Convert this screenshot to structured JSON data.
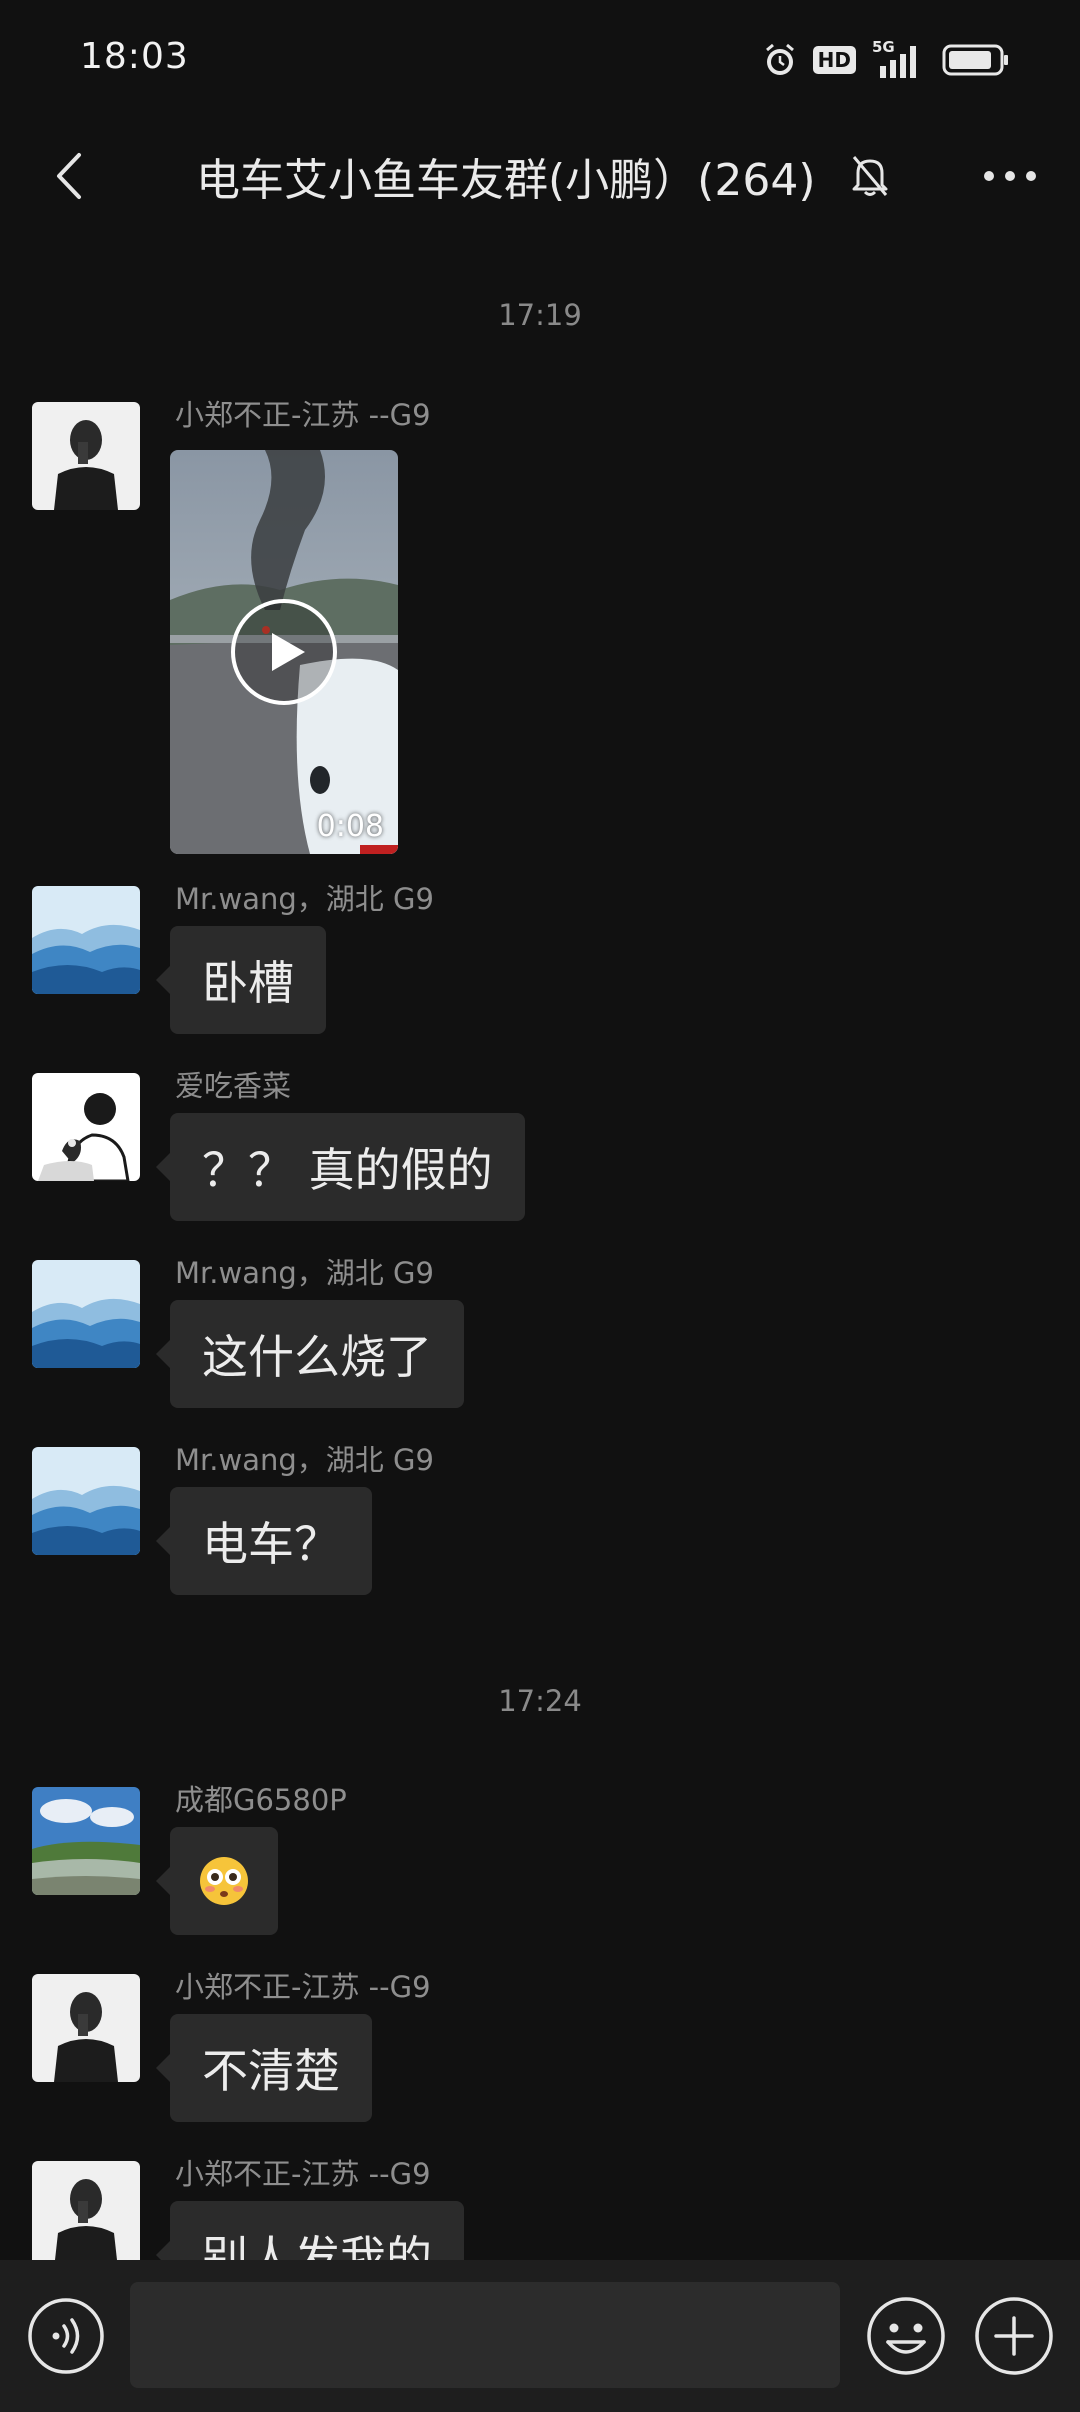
{
  "status_bar": {
    "time": "18:03",
    "icons": [
      "alarm-icon",
      "hd-icon",
      "5g-signal-icon",
      "battery-icon"
    ],
    "network_label": "5G",
    "hd_label": "HD"
  },
  "header": {
    "title": "电车艾小鱼车友群(小鹏）(264)",
    "icons": [
      "back-chevron-icon",
      "mute-bell-icon",
      "more-dots-icon"
    ]
  },
  "chat": {
    "timestamps": [
      "17:19",
      "17:24"
    ],
    "messages": [
      {
        "sender": "小郑不正-江苏 --G9",
        "type": "video",
        "duration": "0:08",
        "avatar": "man-black-white-portrait"
      },
      {
        "sender": "Mr.wang，湖北 G9",
        "type": "text",
        "text": "卧槽",
        "avatar": "blue-mountains"
      },
      {
        "sender": "爱吃香菜",
        "type": "text",
        "text": "？？ 真的假的",
        "avatar": "sketch-person-with-cat"
      },
      {
        "sender": "Mr.wang，湖北 G9",
        "type": "text",
        "text": "这什么烧了",
        "avatar": "blue-mountains"
      },
      {
        "sender": "Mr.wang，湖北 G9",
        "type": "text",
        "text": "电车？",
        "avatar": "blue-mountains"
      },
      {
        "sender": "成都G6580P",
        "type": "emoji",
        "emoji": "flushed-face",
        "avatar": "landscape-sky-lake"
      },
      {
        "sender": "小郑不正-江苏 --G9",
        "type": "text",
        "text": "不清楚",
        "avatar": "man-black-white-portrait"
      },
      {
        "sender": "小郑不正-江苏 --G9",
        "type": "text",
        "text": "别人发我的",
        "avatar": "man-black-white-portrait"
      }
    ]
  },
  "input_bar": {
    "value": "",
    "placeholder": "",
    "icons": [
      "voice-icon",
      "emoji-icon",
      "plus-icon"
    ]
  },
  "colors": {
    "background": "#111111",
    "bubble": "#2b2b2b",
    "input_bar": "#1e1e1e",
    "text": "#ececec",
    "secondary_text": "#8e8e8e"
  }
}
